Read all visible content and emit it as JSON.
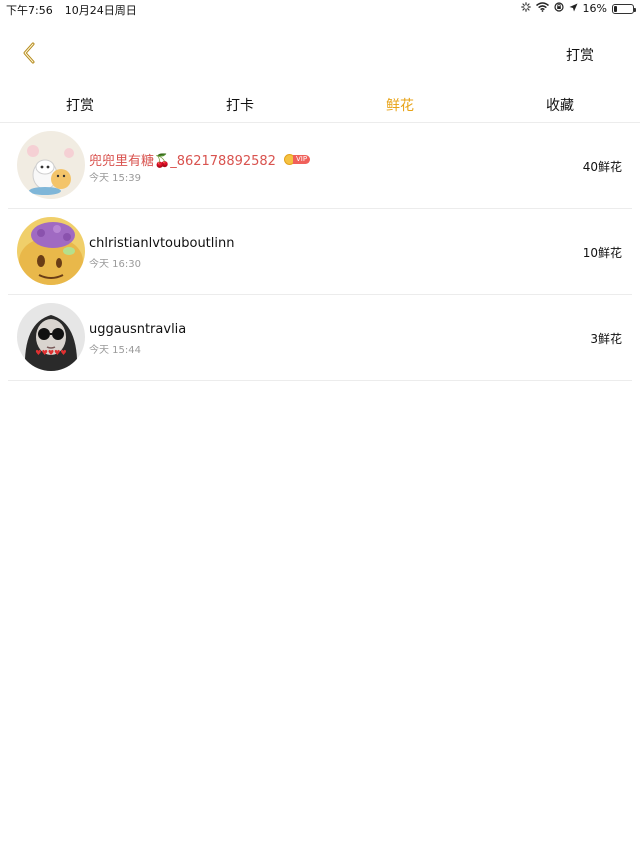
{
  "status_bar": {
    "time": "下午7:56",
    "date": "10月24日周日",
    "battery": "16%",
    "battery_level": 0.16
  },
  "nav": {
    "right_label": "打赏"
  },
  "tabs": [
    {
      "label": "打赏",
      "active": false
    },
    {
      "label": "打卡",
      "active": false
    },
    {
      "label": "鲜花",
      "active": true
    },
    {
      "label": "收藏",
      "active": false
    }
  ],
  "list": [
    {
      "name_prefix": "兜兜里有糖",
      "name_emoji": "🍒",
      "name_suffix": "_862178892582",
      "vip_label": "VIP",
      "time": "今天 15:39",
      "amount": "40鲜花"
    },
    {
      "name": "chlristianlvtouboutlinn",
      "time": "今天 16:30",
      "amount": "10鲜花"
    },
    {
      "name": "uggausntravlia",
      "time": "今天 15:44",
      "amount": "3鲜花"
    }
  ],
  "colors": {
    "accent": "#e8a317",
    "vip_name": "#d9534f",
    "divider": "#ececec",
    "secondary_text": "#9a9a9a"
  }
}
